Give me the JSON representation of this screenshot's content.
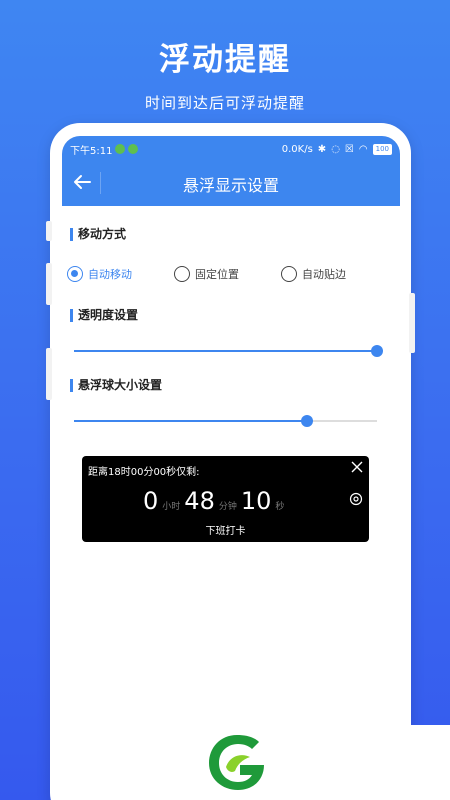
{
  "promo": {
    "title": "浮动提醒",
    "subtitle": "时间到达后可浮动提醒"
  },
  "status_bar": {
    "time": "下午5:11",
    "network_speed": "0.0K/s",
    "battery": "100"
  },
  "header": {
    "title": "悬浮显示设置"
  },
  "settings": {
    "move_mode": {
      "label": "移动方式",
      "options": [
        "自动移动",
        "固定位置",
        "自动贴边"
      ],
      "selected": "自动移动"
    },
    "opacity": {
      "label": "透明度设置",
      "value_fraction": 1.0
    },
    "ball_size": {
      "label": "悬浮球大小设置",
      "value_fraction": 0.77
    }
  },
  "float_preview": {
    "label": "距离18时00分00秒仅剩:",
    "hours": "0",
    "hours_unit": "小时",
    "minutes": "48",
    "minutes_unit": "分钟",
    "seconds": "10",
    "seconds_unit": "秒",
    "footer": "下班打卡"
  },
  "colors": {
    "accent": "#3d86ef",
    "background_top": "#3f86f2",
    "card_bg": "#000000",
    "logo_green": "#1f9a3a"
  }
}
